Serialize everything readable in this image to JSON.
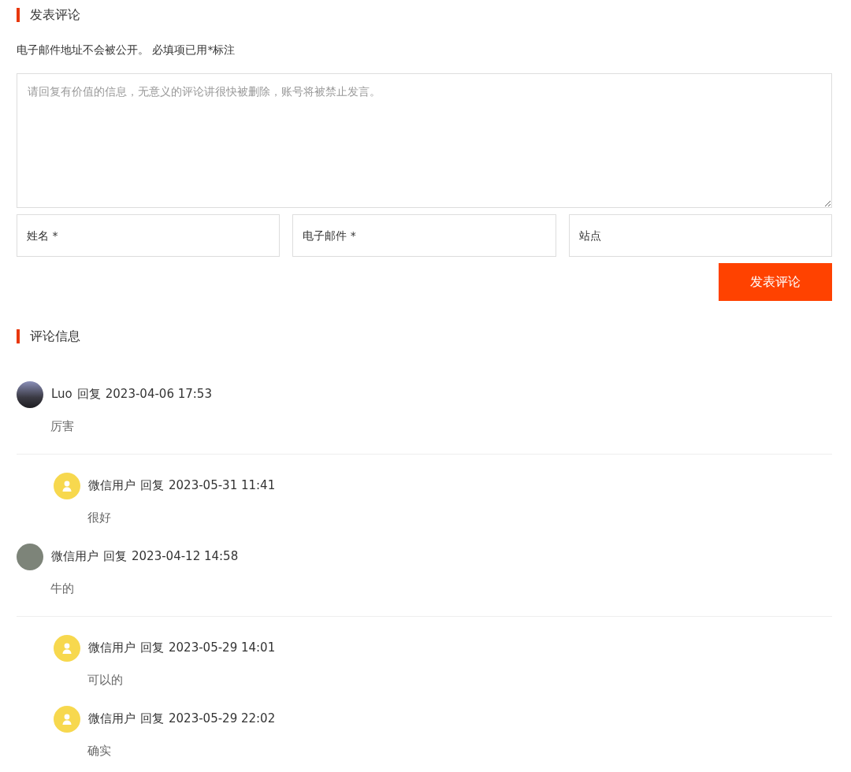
{
  "comment_form": {
    "title": "发表评论",
    "notice": "电子邮件地址不会被公开。 必填项已用*标注",
    "textarea": {
      "placeholder": "请回复有价值的信息，无意义的评论讲很快被删除，账号将被禁止发言。"
    },
    "fields": [
      {
        "placeholder": "姓名 *"
      },
      {
        "placeholder": "电子邮件 *"
      },
      {
        "placeholder": "站点"
      }
    ],
    "submit": "发表评论"
  },
  "comments_section": {
    "title": "评论信息",
    "comments": [
      {
        "kind": "photo",
        "author": "Luo",
        "reply": "回复",
        "date": "2023-04-06 17:53",
        "text": "厉害",
        "children": [
          {
            "kind": "default",
            "author": "微信用户",
            "reply": "回复",
            "date": "2023-05-31 11:41",
            "text": "很好"
          }
        ]
      },
      {
        "kind": "photo",
        "author": "微信用户",
        "reply": "回复",
        "date": "2023-04-12 14:58",
        "text": "牛的",
        "children": [
          {
            "kind": "default",
            "author": "微信用户",
            "reply": "回复",
            "date": "2023-05-29 14:01",
            "text": "可以的"
          },
          {
            "kind": "default",
            "author": "微信用户",
            "reply": "回复",
            "date": "2023-05-29 22:02",
            "text": "确实"
          }
        ]
      }
    ]
  }
}
